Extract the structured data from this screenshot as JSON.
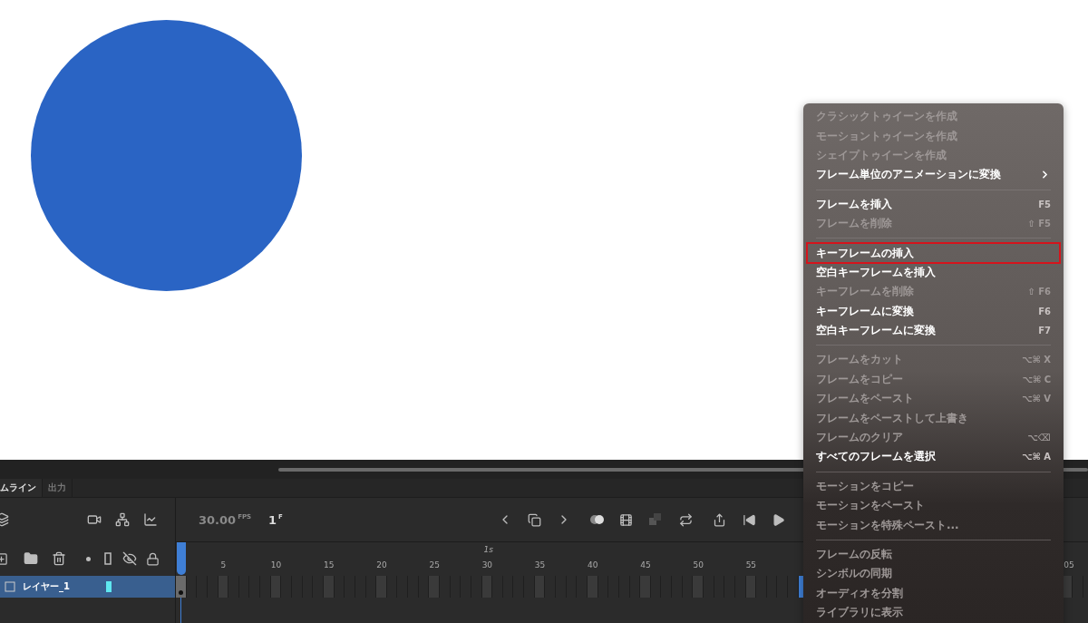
{
  "timeline": {
    "tabs": [
      {
        "label": "ムライン",
        "selected": true
      },
      {
        "label": "出力",
        "selected": false
      }
    ],
    "fps": "30.00",
    "fps_unit": "FPS",
    "frame": "1",
    "frame_unit": "F",
    "seconds": [
      "1s"
    ],
    "ruler_numbers": [
      "5",
      "10",
      "15",
      "20",
      "25",
      "30",
      "35",
      "40",
      "45",
      "50",
      "55"
    ],
    "ruler_edge_label": "05",
    "layers": [
      {
        "name": "レイヤー_1",
        "selected": true
      }
    ]
  },
  "context_menu": {
    "items": [
      {
        "kind": "item",
        "label": "クラシックトゥイーンを作成",
        "disabled": true
      },
      {
        "kind": "item",
        "label": "モーショントゥイーンを作成",
        "disabled": true
      },
      {
        "kind": "item",
        "label": "シェイプトゥイーンを作成",
        "disabled": true
      },
      {
        "kind": "item",
        "label": "フレーム単位のアニメーションに変換",
        "disabled": false,
        "submenu": true
      },
      {
        "kind": "separator"
      },
      {
        "kind": "item",
        "label": "フレームを挿入",
        "shortcut": "F5",
        "disabled": false
      },
      {
        "kind": "item",
        "label": "フレームを削除",
        "shortcut": "⇧ F5",
        "disabled": true
      },
      {
        "kind": "separator"
      },
      {
        "kind": "item",
        "label": "キーフレームの挿入",
        "disabled": false,
        "outlined": true
      },
      {
        "kind": "item",
        "label": "空白キーフレームを挿入",
        "disabled": false
      },
      {
        "kind": "item",
        "label": "キーフレームを削除",
        "shortcut": "⇧ F6",
        "disabled": true
      },
      {
        "kind": "item",
        "label": "キーフレームに変換",
        "shortcut": "F6",
        "disabled": false
      },
      {
        "kind": "item",
        "label": "空白キーフレームに変換",
        "shortcut": "F7",
        "disabled": false
      },
      {
        "kind": "separator"
      },
      {
        "kind": "item",
        "label": "フレームをカット",
        "shortcut": "⌥⌘ X",
        "disabled": true
      },
      {
        "kind": "item",
        "label": "フレームをコピー",
        "shortcut": "⌥⌘ C",
        "disabled": true
      },
      {
        "kind": "item",
        "label": "フレームをペースト",
        "shortcut": "⌥⌘ V",
        "disabled": true
      },
      {
        "kind": "item",
        "label": "フレームをペーストして上書き",
        "disabled": true
      },
      {
        "kind": "item",
        "label": "フレームのクリア",
        "shortcut": "⌥⌫",
        "disabled": true
      },
      {
        "kind": "item",
        "label": "すべてのフレームを選択",
        "shortcut": "⌥⌘ A",
        "disabled": false
      },
      {
        "kind": "separator"
      },
      {
        "kind": "item",
        "label": "モーションをコピー",
        "disabled": true
      },
      {
        "kind": "item",
        "label": "モーションをペースト",
        "disabled": true
      },
      {
        "kind": "item",
        "label": "モーションを特殊ペースト...",
        "disabled": true
      },
      {
        "kind": "separator"
      },
      {
        "kind": "item",
        "label": "フレームの反転",
        "disabled": true
      },
      {
        "kind": "item",
        "label": "シンボルの同期",
        "disabled": true
      },
      {
        "kind": "item",
        "label": "オーディオを分割",
        "disabled": true
      },
      {
        "kind": "item",
        "label": "ライブラリに表示",
        "disabled": true
      }
    ]
  }
}
